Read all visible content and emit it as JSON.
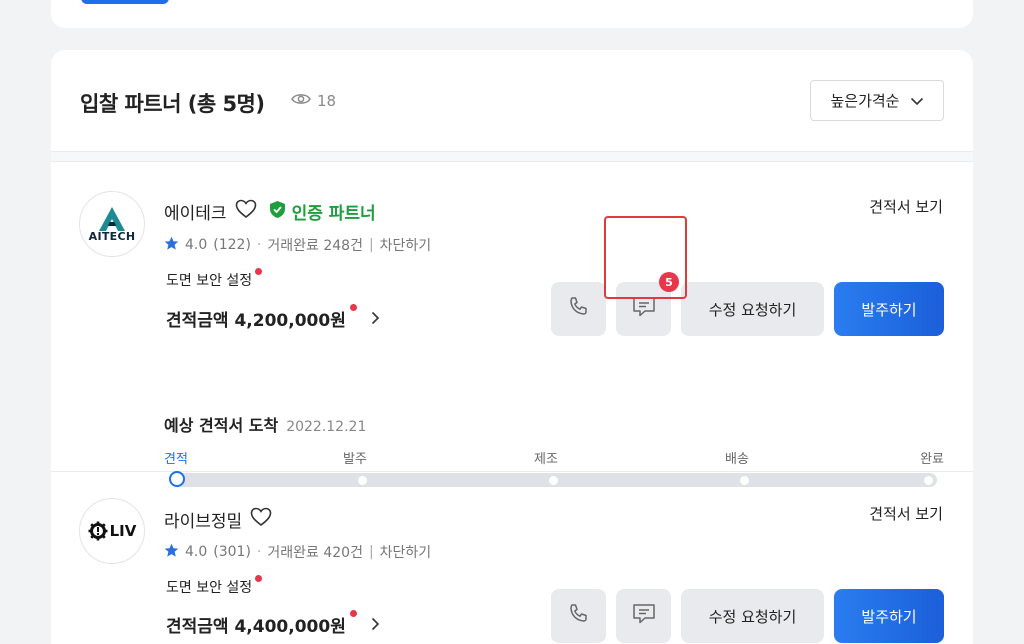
{
  "header": {
    "title": "입찰 파트너 (총 5명)",
    "view_count": "18",
    "sort_label": "높은가격순"
  },
  "partners": [
    {
      "name": "에이테크",
      "logo_text": "AITECH",
      "certified_label": "인증 파트너",
      "rating": "4.0",
      "reviews": "(122)",
      "deals": "거래완료 248건",
      "block": "차단하기",
      "security": "도면 보안 설정",
      "amount": "견적금액 4,200,000원",
      "view_quote": "견적서 보기",
      "chat_badge": "5",
      "revise_label": "수정 요청하기",
      "order_label": "발주하기",
      "eta_label": "예상 견적서 도착",
      "eta_date": "2022.12.21",
      "steps": [
        "견적",
        "발주",
        "제조",
        "배송",
        "완료"
      ],
      "current_step": 0
    },
    {
      "name": "라이브정밀",
      "logo_text": "LIV",
      "rating": "4.0",
      "reviews": "(301)",
      "deals": "거래완료 420건",
      "block": "차단하기",
      "security": "도면 보안 설정",
      "amount": "견적금액 4,400,000원",
      "view_quote": "견적서 보기",
      "revise_label": "수정 요청하기",
      "order_label": "발주하기"
    }
  ],
  "colors": {
    "accent": "#1f6fe8",
    "certified": "#1e9e3c",
    "alert": "#e8364a",
    "star": "#2a6fe0"
  }
}
